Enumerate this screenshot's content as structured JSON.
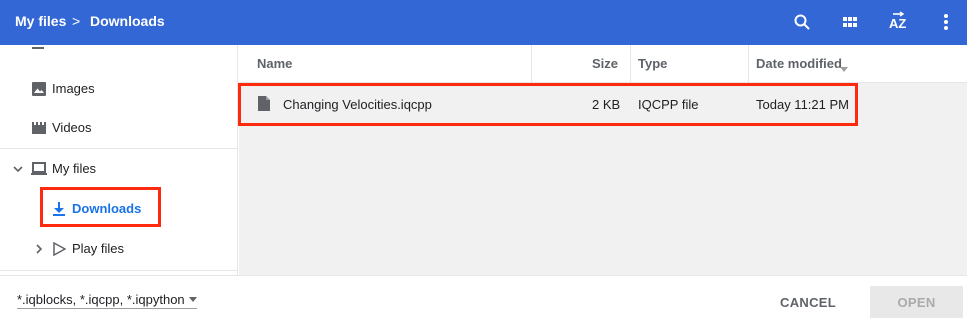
{
  "header": {
    "breadcrumb": [
      "My files",
      "Downloads"
    ],
    "separator": ">",
    "icons": [
      "search-icon",
      "grid-view-icon",
      "sort-az-icon",
      "more-vert-icon"
    ]
  },
  "sidebar": {
    "items": [
      {
        "label": "Images",
        "icon": "image-icon"
      },
      {
        "label": "Videos",
        "icon": "video-icon"
      },
      {
        "label": "My files",
        "icon": "laptop-icon"
      },
      {
        "label": "Downloads",
        "icon": "download-icon",
        "selected": true
      },
      {
        "label": "Play files",
        "icon": "play-icon"
      }
    ]
  },
  "file_list": {
    "columns": {
      "name": "Name",
      "size": "Size",
      "type": "Type",
      "date": "Date modified"
    },
    "rows": [
      {
        "name": "Changing Velocities.iqcpp",
        "size": "2 KB",
        "type": "IQCPP file",
        "date": "Today 11:21 PM",
        "icon": "file-icon"
      }
    ]
  },
  "footer": {
    "filter": "*.iqblocks, *.iqcpp, *.iqpython",
    "cancel": "CANCEL",
    "open": "OPEN"
  },
  "colors": {
    "header": "#3367d6",
    "accent": "#1a73e8",
    "highlight": "#ff2a0e"
  }
}
